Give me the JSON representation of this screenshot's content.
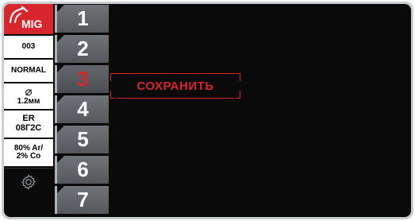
{
  "mode": {
    "label": "MIG",
    "icon": "mig-torch-icon",
    "accent": "#d7262e"
  },
  "status": {
    "program": "003",
    "mode_setting": "NORMAL",
    "diameter_symbol": "⌀",
    "diameter": "1.2мм",
    "wire_line1": "ER",
    "wire_line2": "08Г2С",
    "gas_line1": "80% Ar/",
    "gas_line2": "2% Co",
    "settings_icon": "gear-icon"
  },
  "tabs": [
    {
      "label": "1",
      "active": false
    },
    {
      "label": "2",
      "active": false
    },
    {
      "label": "3",
      "active": true
    },
    {
      "label": "4",
      "active": false
    },
    {
      "label": "5",
      "active": false
    },
    {
      "label": "6",
      "active": false
    },
    {
      "label": "7",
      "active": false
    }
  ],
  "save": {
    "label": "СОХРАНИТЬ"
  },
  "colors": {
    "accent": "#d7262e",
    "tab": "#5f6368",
    "background": "#0a0a0a"
  }
}
